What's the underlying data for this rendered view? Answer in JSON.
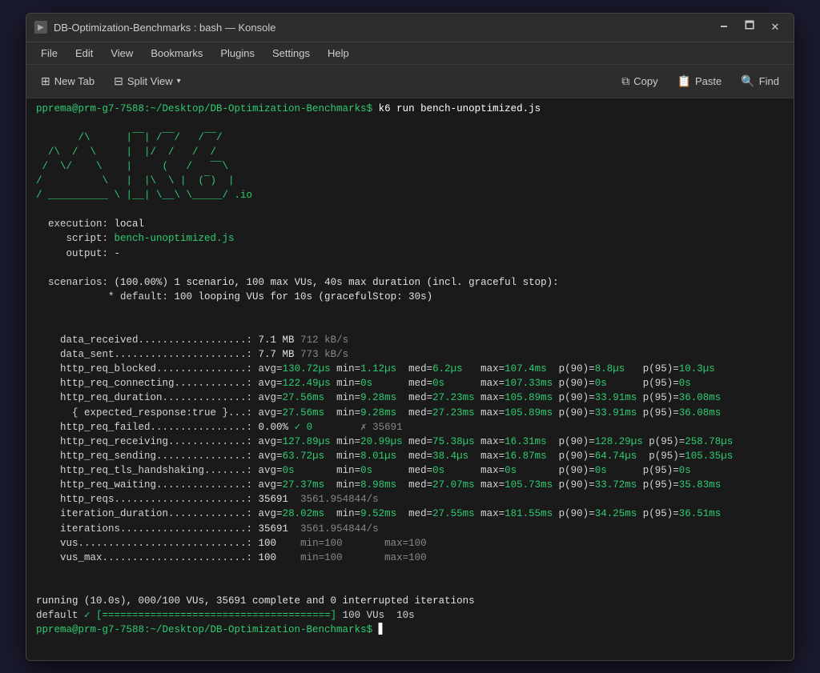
{
  "window": {
    "title": "DB-Optimization-Benchmarks : bash — Konsole",
    "icon": "▶"
  },
  "titlebar": {
    "minimize": "🗕",
    "maximize": "🗖",
    "close": "✕"
  },
  "menu": {
    "items": [
      "File",
      "Edit",
      "View",
      "Bookmarks",
      "Plugins",
      "Settings",
      "Help"
    ]
  },
  "toolbar": {
    "new_tab": "New Tab",
    "split_view": "Split View",
    "copy": "Copy",
    "paste": "Paste",
    "find": "Find"
  },
  "terminal": {
    "prompt": "pprema@prm-g7-7588:~/Desktop/DB-Optimization-Benchmarks$",
    "command": "k6 run bench-unoptimized.js",
    "k6_logo": [
      "       /\\      |‾‾| /‾‾/   /‾‾/   ",
      "  /\\  /  \\     |  |/  /   /  /    ",
      " /  \\/    \\    |     (   /   ‾‾\\  ",
      "/          \\   |  |\\  \\ |  (‾)  | ",
      "/ __________ \\ |__| \\__\\ \\_____/ .io"
    ],
    "execution_info": [
      "execution: local",
      "   script: bench-unoptimized.js",
      "   output: -",
      "",
      "scenarios: (100.00%) 1 scenario, 100 max VUs, 40s max duration (incl. graceful stop):",
      "          * default: 100 looping VUs for 10s (gracefulStop: 30s)"
    ],
    "metrics": [
      "data_received..................: 7.1 MB 712 kB/s",
      "data_sent......................: 7.7 MB 773 kB/s",
      "http_req_blocked...............: avg=130.72µs min=1.12µs  med=6.2µs   max=107.4ms  p(90)=8.8µs   p(95)=10.3µs",
      "http_req_connecting............: avg=122.49µs min=0s      med=0s      max=107.33ms p(90)=0s      p(95)=0s",
      "http_req_duration..............: avg=27.56ms  min=9.28ms  med=27.23ms max=105.89ms p(90)=33.91ms p(95)=36.08ms",
      "  { expected_response:true }...: avg=27.56ms  min=9.28ms  med=27.23ms max=105.89ms p(90)=33.91ms p(95)=36.08ms",
      "http_req_failed................: 0.00% ✓ 0        ✗ 35691",
      "http_req_receiving.............: avg=127.89µs min=20.99µs med=75.38µs max=16.31ms  p(90)=128.29µs p(95)=258.78µs",
      "http_req_sending...............: avg=63.72µs  min=8.01µs  med=38.4µs  max=16.87ms  p(90)=64.74µs  p(95)=105.35µs",
      "http_req_tls_handshaking.......: avg=0s        min=0s      med=0s      max=0s       p(90)=0s      p(95)=0s",
      "http_req_waiting...............: avg=27.37ms  min=8.98ms  med=27.07ms max=105.73ms p(90)=33.72ms p(95)=35.83ms",
      "http_reqs......................: 35691  3561.954844/s",
      "iteration_duration.............: avg=28.02ms  min=9.52ms  med=27.55ms max=181.55ms p(90)=34.25ms p(95)=36.51ms",
      "iterations.....................: 35691  3561.954844/s",
      "vus............................: 100    min=100       max=100",
      "vus_max........................: 100    min=100       max=100"
    ],
    "footer": [
      "running (10.0s), 000/100 VUs, 35691 complete and 0 interrupted iterations",
      "default ✓ [======================================] 100 VUs  10s"
    ],
    "prompt2": "pprema@prm-g7-7588:~/Desktop/DB-Optimization-Benchmarks$"
  }
}
